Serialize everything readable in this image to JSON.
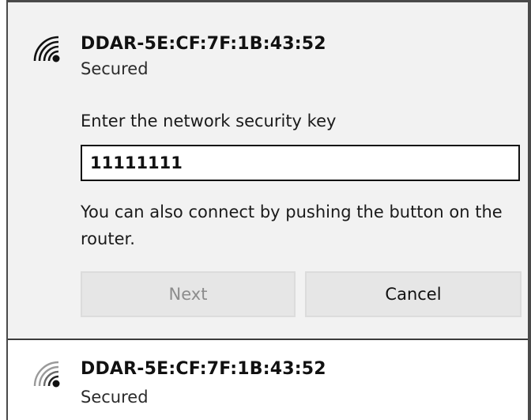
{
  "networks": [
    {
      "ssid": "DDAR-5E:CF:7F:1B:43:52",
      "status": "Secured",
      "icon": "wifi-secured-icon",
      "expanded": true,
      "key_prompt": "Enter the network security key",
      "key_value": "11111111",
      "hint": "You can also connect by pushing the button on the router.",
      "next_label": "Next",
      "cancel_label": "Cancel"
    },
    {
      "ssid": "DDAR-5E:CF:7F:1B:43:52",
      "status": "Secured",
      "icon": "wifi-secured-icon",
      "expanded": false
    }
  ],
  "colors": {
    "selected_bg": "#f2f2f2",
    "button_bg": "#e6e6e6",
    "disabled_text": "#8c8c8c"
  }
}
